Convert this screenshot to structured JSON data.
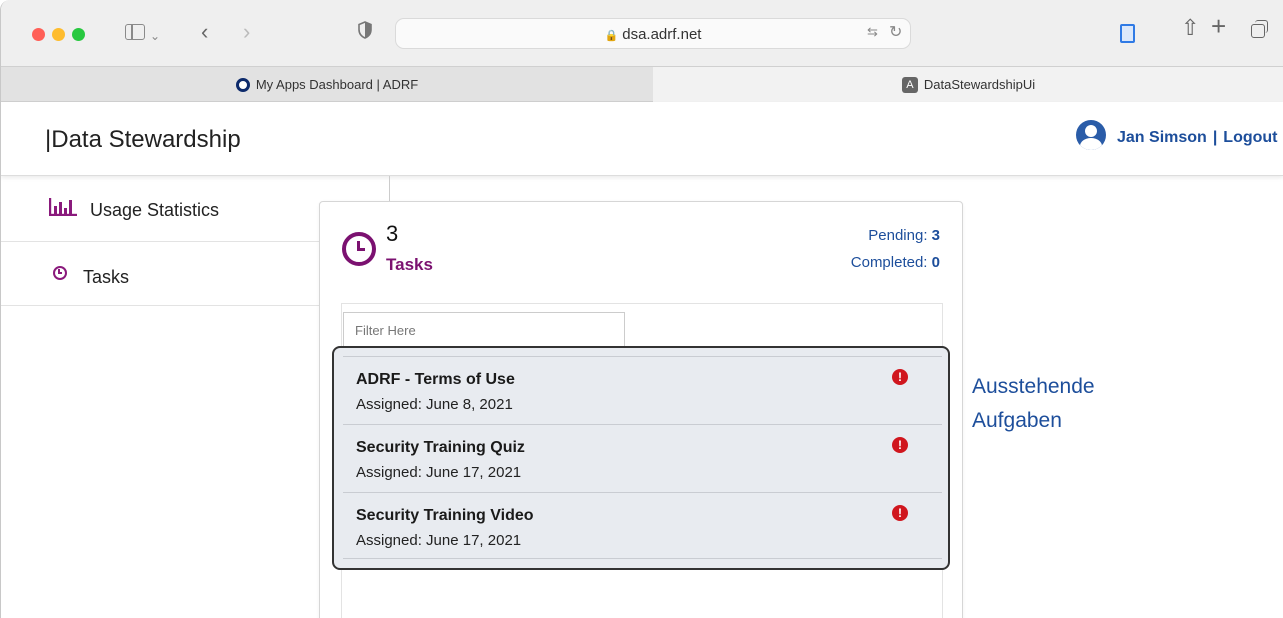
{
  "browser": {
    "url": "dsa.adrf.net",
    "tabs": [
      {
        "label": "My Apps Dashboard | ADRF",
        "favicon": "o-circle-icon"
      },
      {
        "label": "DataStewardshipUi",
        "favicon_letter": "A"
      }
    ]
  },
  "header": {
    "brand": "|Data Stewardship",
    "user_name": "Jan Simson",
    "separator": "|",
    "logout": "Logout"
  },
  "sidenav": {
    "items": [
      {
        "label": "Usage Statistics",
        "icon": "bar-chart-icon"
      },
      {
        "label": "Tasks",
        "icon": "clock-icon"
      }
    ]
  },
  "card": {
    "count": "3",
    "title": "Tasks",
    "pending_label": "Pending:",
    "pending_value": "3",
    "completed_label": "Completed:",
    "completed_value": "0",
    "filter_placeholder": "Filter Here",
    "tasks": [
      {
        "name": "ADRF - Terms of Use",
        "assigned": "Assigned: June 8, 2021"
      },
      {
        "name": "Security Training Quiz",
        "assigned": "Assigned: June 17, 2021"
      },
      {
        "name": "Security Training Video",
        "assigned": "Assigned: June 17, 2021"
      }
    ],
    "alert_glyph": "!"
  },
  "annotation": {
    "line1": "Ausstehende",
    "line2": "Aufgaben"
  },
  "colors": {
    "accent_purple": "#7b1170",
    "link_blue": "#1d4e9b",
    "alert_red": "#d0161e"
  }
}
